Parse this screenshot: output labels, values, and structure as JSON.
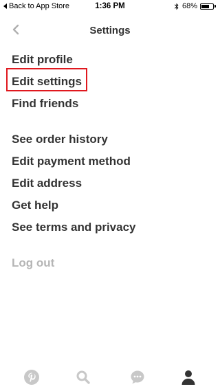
{
  "status_bar": {
    "back_label": "Back to App Store",
    "time": "1:36 PM",
    "battery_percent": "68%",
    "battery_level": 0.68
  },
  "nav": {
    "title": "Settings",
    "back_icon": "chevron-left-icon"
  },
  "menu": {
    "group1": [
      "Edit profile",
      "Edit settings",
      "Find friends"
    ],
    "group2": [
      "See order history",
      "Edit payment method",
      "Edit address",
      "Get help",
      "See terms and privacy"
    ],
    "logout": "Log out"
  },
  "highlighted_item": "Edit settings",
  "colors": {
    "text": "#333333",
    "muted": "#b5b5b5",
    "highlight_border": "#e0181e",
    "tab_icon": "#c8c8c8",
    "tab_icon_active": "#333333"
  },
  "tabs": [
    {
      "icon": "pinterest-logo-icon",
      "active": false
    },
    {
      "icon": "search-icon",
      "active": false
    },
    {
      "icon": "chat-bubble-icon",
      "active": false
    },
    {
      "icon": "profile-icon",
      "active": true
    }
  ]
}
